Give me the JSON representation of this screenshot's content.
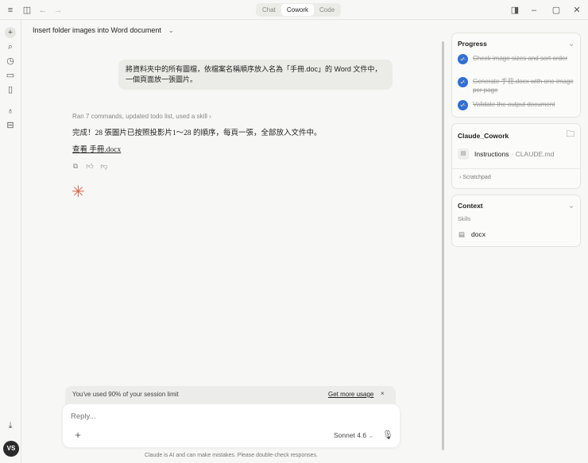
{
  "titlebar": {
    "tabs": [
      "Chat",
      "Cowork",
      "Code"
    ],
    "active": "Cowork"
  },
  "conversation": {
    "title": "Insert folder images into Word document",
    "user_message": "將資料夾中的所有圖檔，依檔案名稱順序放入名為「手冊.doc」的 Word 文件中，一個頁面放一張圖片。",
    "tool_summary": "Ran 7 commands, updated todo list, used a skill",
    "reply": "完成！28 張圖片已按照投影片1～28 的順序，每頁一張，全部放入文件中。",
    "link": "查看 手冊.docx"
  },
  "usage": {
    "text": "You've used 90% of your session limit",
    "action": "Get more usage"
  },
  "composer": {
    "placeholder": "Reply...",
    "model": "Sonnet 4.6",
    "disclaimer": "Claude is AI and can make mistakes. Please double-check responses."
  },
  "progress": {
    "title": "Progress",
    "tasks": [
      "Check image sizes and sort order",
      "Generate 手冊.docx with one image per page",
      "Validate the output document"
    ]
  },
  "workspace": {
    "title": "Claude_Cowork",
    "file": "Instructions",
    "file_sub": "· CLAUDE.md",
    "scratchpad": "Scratchpad"
  },
  "context": {
    "title": "Context",
    "skills_label": "Skills",
    "skill": "docx"
  },
  "user": {
    "initials": "VS"
  },
  "colors": {
    "accent": "#2f6fd8",
    "spark": "#d9664a"
  }
}
